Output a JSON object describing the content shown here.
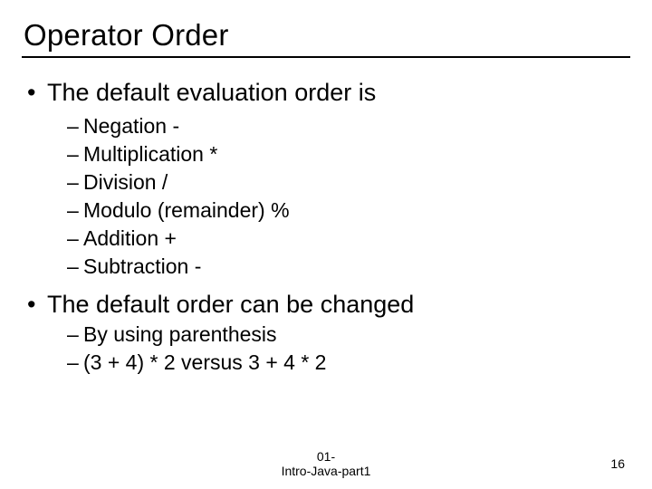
{
  "title": "Operator Order",
  "points": [
    {
      "text": "The default evaluation order is",
      "subs": [
        "Negation -",
        "Multiplication *",
        "Division /",
        "Modulo (remainder) %",
        "Addition +",
        "Subtraction -"
      ]
    },
    {
      "text": "The default order can be changed",
      "subs": [
        "By using parenthesis",
        "(3 + 4) * 2 versus 3 + 4 * 2"
      ]
    }
  ],
  "footer": {
    "line1": "01-",
    "line2": "Intro-Java-part1"
  },
  "page_number": "16"
}
